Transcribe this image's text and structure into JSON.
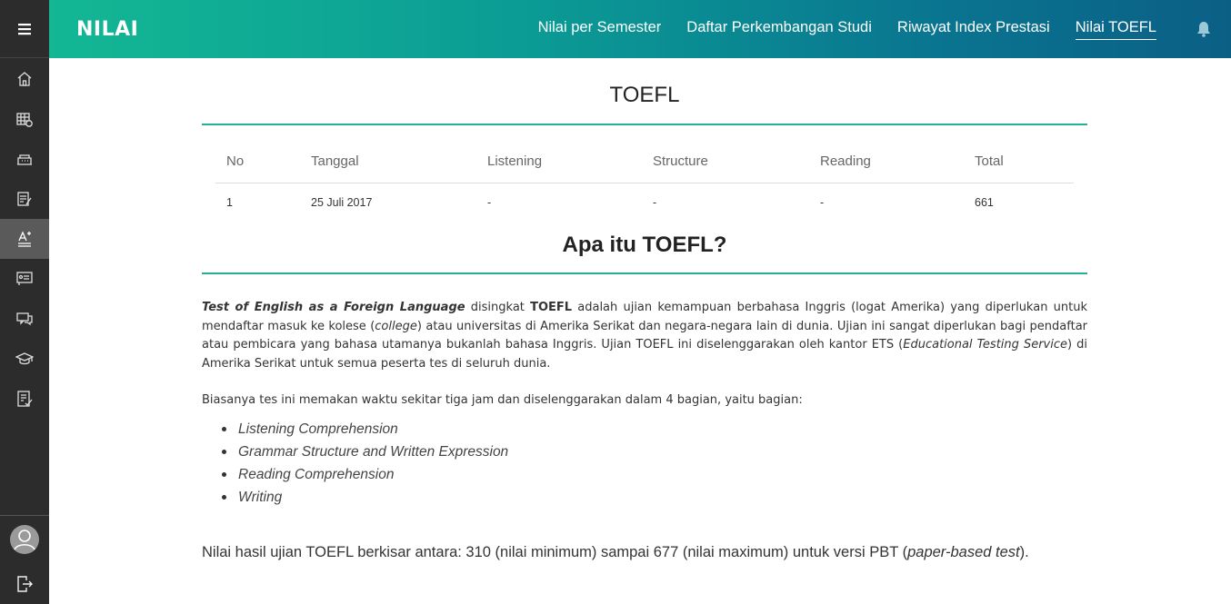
{
  "app": {
    "brand": "NILAI"
  },
  "nav": {
    "items": [
      {
        "label": "Nilai per Semester"
      },
      {
        "label": "Daftar Perkembangan Studi"
      },
      {
        "label": "Riwayat Index Prestasi"
      },
      {
        "label": "Nilai TOEFL",
        "active": true
      }
    ]
  },
  "sidebar": {
    "icons": [
      "home-icon",
      "schedule-icon",
      "building-icon",
      "document-edit-icon",
      "grade-icon",
      "presentation-icon",
      "chat-icon",
      "graduation-cap-icon",
      "checklist-icon"
    ],
    "active_index": 4
  },
  "page": {
    "title": "TOEFL"
  },
  "table": {
    "headers": [
      "No",
      "Tanggal",
      "Listening",
      "Structure",
      "Reading",
      "Total"
    ],
    "rows": [
      [
        "1",
        "25 Juli 2017",
        "-",
        "-",
        "-",
        "661"
      ]
    ]
  },
  "info": {
    "title": "Apa itu TOEFL?",
    "para1": {
      "term": "Test of English as a Foreign Language",
      "t1": " disingkat ",
      "abbr": "TOEFL",
      "t2": " adalah ujian kemampuan berbahasa Inggris (logat Amerika) yang diperlukan untuk mendaftar masuk ke kolese (",
      "college": "college",
      "t3": ") atau universitas di Amerika Serikat dan negara-negara lain di dunia. Ujian ini sangat diperlukan bagi pendaftar atau pembicara yang bahasa utamanya bukanlah bahasa Inggris. Ujian TOEFL ini diselenggarakan oleh kantor ETS (",
      "ets": "Educational Testing Service",
      "t4": ") di Amerika Serikat untuk semua peserta tes di seluruh dunia."
    },
    "para2": "Biasanya tes ini memakan waktu sekitar tiga jam dan diselenggarakan dalam 4 bagian, yaitu bagian:",
    "parts": [
      "Listening Comprehension",
      "Grammar Structure and Written Expression",
      "Reading Comprehension",
      "Writing"
    ],
    "range": {
      "t1": "Nilai hasil ujian TOEFL berkisar antara: 310 (nilai minimum) sampai 677 (nilai maximum) untuk versi PBT (",
      "pbt": "paper-based test",
      "t2": ")."
    }
  },
  "colors": {
    "accent": "#26b09a",
    "header_start": "#13b794",
    "header_end": "#0b5f86",
    "sidebar": "#2c2c2c"
  }
}
